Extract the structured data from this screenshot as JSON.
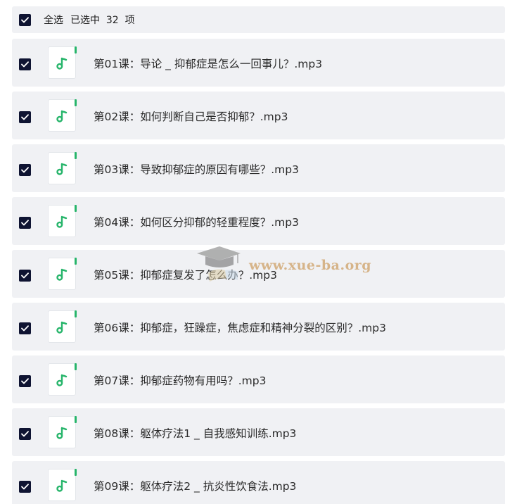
{
  "header": {
    "select_all_label": "全选",
    "selected_text": "已选中  32  项",
    "checked": true
  },
  "files": [
    {
      "name": "第01课：导论 _ 抑郁症是怎么一回事儿？.mp3",
      "checked": true
    },
    {
      "name": "第02课：如何判断自己是否抑郁？.mp3",
      "checked": true
    },
    {
      "name": "第03课：导致抑郁症的原因有哪些？.mp3",
      "checked": true
    },
    {
      "name": "第04课：如何区分抑郁的轻重程度？.mp3",
      "checked": true
    },
    {
      "name": "第05课：抑郁症复发了怎么办？.mp3",
      "checked": true
    },
    {
      "name": "第06课：抑郁症，狂躁症，焦虑症和精神分裂的区别？.mp3",
      "checked": true
    },
    {
      "name": "第07课：抑郁症药物有用吗？.mp3",
      "checked": true
    },
    {
      "name": "第08课：躯体疗法1 _ 自我感知训练.mp3",
      "checked": true
    },
    {
      "name": "第09课：躯体疗法2 _ 抗炎性饮食法.mp3",
      "checked": true
    }
  ],
  "icons": {
    "checkbox": "checkmark-icon",
    "file": "music-note-icon"
  },
  "colors": {
    "checkbox_fill": "#0f1432",
    "row_background": "#f0f1f4",
    "audio_accent": "#27b56b",
    "watermark": "#cc9c60"
  },
  "watermark": {
    "text": "www.xue-ba.org"
  }
}
